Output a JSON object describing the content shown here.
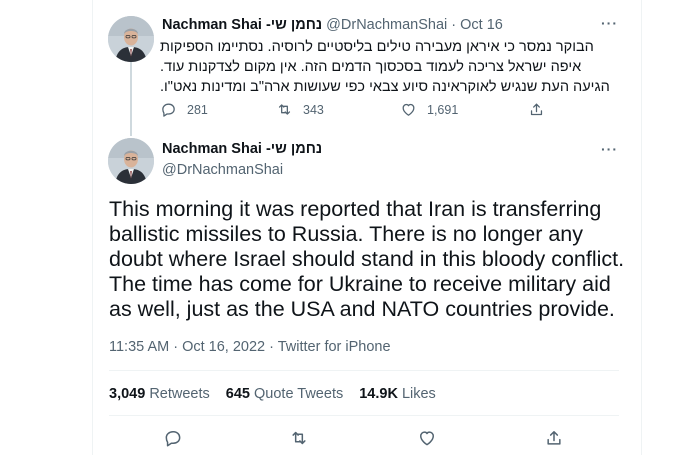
{
  "reply_tweet": {
    "display_name": "Nachman Shai -נחמן שי",
    "handle": "@DrNachmanShai",
    "separator": "·",
    "date": "Oct 16",
    "more": "···",
    "text_lines": [
      "הבוקר נמסר כי איראן מעבירה טילים בליסטיים לרוסיה. נסתיימו הספיקות",
      "איפה ישראל צריכה לעמוד בסכסוך הדמים הזה. אין מקום לצדקנות עוד.",
      "הגיעה העת שנגיש לאוקראינה סיוע צבאי כפי שעושות ארה\"ב ומדינות נאט\"ו."
    ],
    "reply_count": "281",
    "retweet_count": "343",
    "like_count": "1,691"
  },
  "main_tweet": {
    "display_name": "Nachman Shai -נחמן שי",
    "handle": "@DrNachmanShai",
    "more": "···",
    "text_lines": [
      "This morning it was reported that Iran is transferring",
      "ballistic missiles to Russia. There is no longer any",
      "doubt where Israel should stand in this bloody conflict.",
      "The time has come for Ukraine to receive military aid",
      "as well, just as the USA and NATO countries provide."
    ],
    "timestamp": "11:35 AM · Oct 16, 2022 · Twitter for iPhone",
    "retweets_count": "3,049",
    "retweets_label": "Retweets",
    "quote_count": "645",
    "quote_label": "Quote Tweets",
    "likes_count": "14.9K",
    "likes_label": "Likes"
  },
  "colors": {
    "text": "#0f1419",
    "secondary": "#536471",
    "divider": "#eff3f4",
    "thread_line": "#cfd9de"
  }
}
